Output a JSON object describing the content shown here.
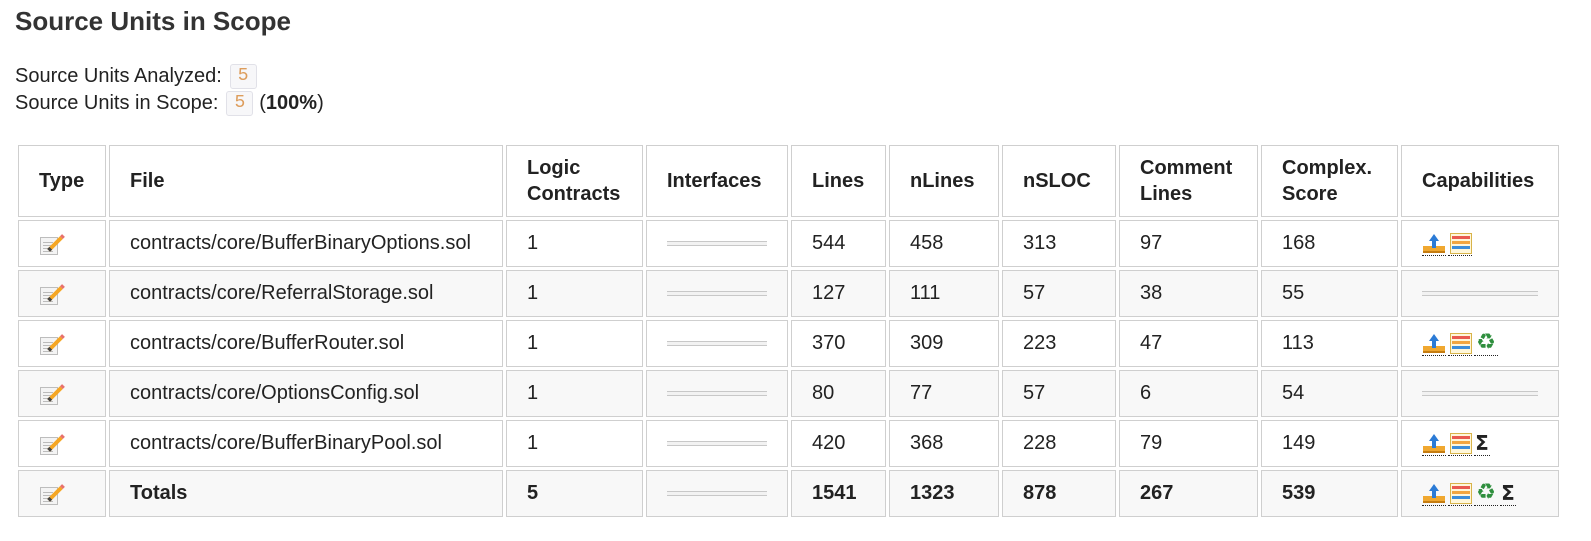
{
  "page": {
    "title": "Source Units in Scope",
    "analyzed_label": "Source Units Analyzed:",
    "analyzed_value": "5",
    "in_scope_label": "Source Units in Scope:",
    "in_scope_value": "5",
    "in_scope_paren_open": "(",
    "in_scope_percent": "100%",
    "in_scope_paren_close": ")"
  },
  "table": {
    "headers": {
      "type": "Type",
      "file": "File",
      "logic_1": "Logic",
      "logic_2": "Contracts",
      "interfaces": "Interfaces",
      "lines": "Lines",
      "nlines": "nLines",
      "nsloc": "nSLOC",
      "comment_1": "Comment",
      "comment_2": "Lines",
      "score_1": "Complex.",
      "score_2": "Score",
      "capabilities": "Capabilities"
    },
    "rows": [
      {
        "type_icon": "memo-icon",
        "file": "contracts/core/BufferBinaryOptions.sol",
        "logic": "1",
        "interfaces": "",
        "lines": "544",
        "nlines": "458",
        "nsloc": "313",
        "comment": "97",
        "score": "168",
        "capabilities": [
          "upload-icon",
          "ledger-icon"
        ]
      },
      {
        "type_icon": "memo-icon",
        "file": "contracts/core/ReferralStorage.sol",
        "logic": "1",
        "interfaces": "",
        "lines": "127",
        "nlines": "111",
        "nsloc": "57",
        "comment": "38",
        "score": "55",
        "capabilities": []
      },
      {
        "type_icon": "memo-icon",
        "file": "contracts/core/BufferRouter.sol",
        "logic": "1",
        "interfaces": "",
        "lines": "370",
        "nlines": "309",
        "nsloc": "223",
        "comment": "47",
        "score": "113",
        "capabilities": [
          "upload-icon",
          "ledger-icon",
          "recycle-icon"
        ]
      },
      {
        "type_icon": "memo-icon",
        "file": "contracts/core/OptionsConfig.sol",
        "logic": "1",
        "interfaces": "",
        "lines": "80",
        "nlines": "77",
        "nsloc": "57",
        "comment": "6",
        "score": "54",
        "capabilities": []
      },
      {
        "type_icon": "memo-icon",
        "file": "contracts/core/BufferBinaryPool.sol",
        "logic": "1",
        "interfaces": "",
        "lines": "420",
        "nlines": "368",
        "nsloc": "228",
        "comment": "79",
        "score": "149",
        "capabilities": [
          "upload-icon",
          "ledger-icon",
          "sigma-icon"
        ]
      }
    ],
    "totals": {
      "type_icon": "memo-icon",
      "file": "Totals",
      "logic": "5",
      "interfaces": "",
      "lines": "1541",
      "nlines": "1323",
      "nsloc": "878",
      "comment": "267",
      "score": "539",
      "capabilities": [
        "upload-icon",
        "ledger-icon",
        "recycle-icon",
        "sigma-icon"
      ]
    }
  },
  "icon_glyphs": {
    "recycle-icon": "♻",
    "sigma-icon": "Σ"
  }
}
